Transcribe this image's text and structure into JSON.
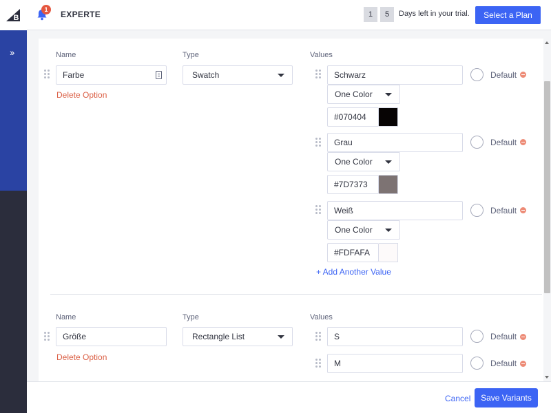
{
  "header": {
    "store_name": "EXPERTE",
    "notification_count": "1",
    "trial_days": [
      "1",
      "5"
    ],
    "trial_text": "Days left in your trial.",
    "select_plan_label": "Select a Plan"
  },
  "colors": {
    "brand_blue": "#3c64f4",
    "nav_dark": "#2b2d3c",
    "nav_blue": "#2a43a3",
    "danger": "#db6147"
  },
  "options": [
    {
      "name_label": "Name",
      "type_label": "Type",
      "values_label": "Values",
      "name_value": "Farbe",
      "type_value": "Swatch",
      "delete_label": "Delete Option",
      "values": [
        {
          "value": "Schwarz",
          "color_mode": "One Color",
          "hex": "#070404",
          "default_label": "Default"
        },
        {
          "value": "Grau",
          "color_mode": "One Color",
          "hex": "#7D7373",
          "default_label": "Default"
        },
        {
          "value": "Weiß",
          "color_mode": "One Color",
          "hex": "#FDFAFA",
          "default_label": "Default"
        }
      ],
      "add_value_label": "+ Add Another Value"
    },
    {
      "name_label": "Name",
      "type_label": "Type",
      "values_label": "Values",
      "name_value": "Größe",
      "type_value": "Rectangle List",
      "delete_label": "Delete Option",
      "values": [
        {
          "value": "S",
          "default_label": "Default"
        },
        {
          "value": "M",
          "default_label": "Default"
        }
      ]
    }
  ],
  "footer": {
    "cancel_label": "Cancel",
    "save_label": "Save Variants"
  },
  "icons": {
    "logo": "bigcommerce-logo-icon",
    "expand": "double-chevron-right-icon",
    "bell": "bell-icon",
    "grip": "drag-handle-icon",
    "remove": "minus-circle-icon"
  }
}
